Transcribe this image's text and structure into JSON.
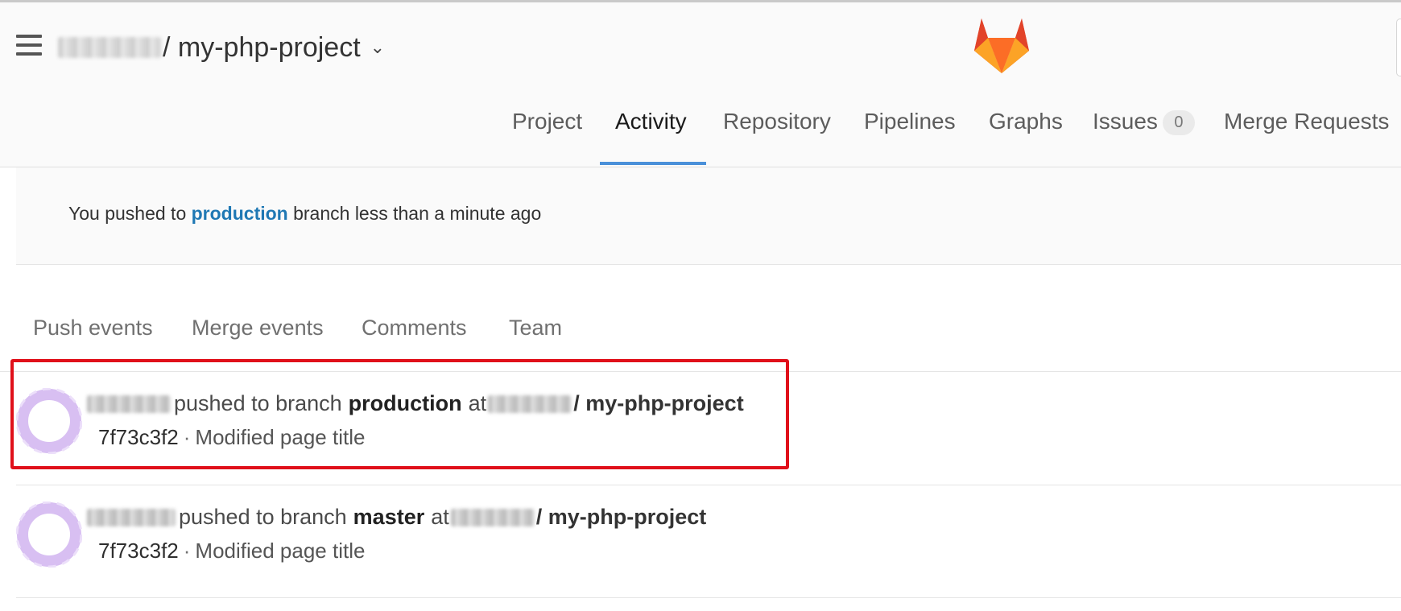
{
  "header": {
    "project_name": "/ my-php-project",
    "menu_icon": "hamburger-menu-icon",
    "dropdown_icon": "chevron-down-icon",
    "logo_icon": "gitlab-fox-logo"
  },
  "nav": {
    "tabs": [
      {
        "label": "Project"
      },
      {
        "label": "Activity",
        "active": true
      },
      {
        "label": "Repository"
      },
      {
        "label": "Pipelines"
      },
      {
        "label": "Graphs"
      },
      {
        "label": "Issues",
        "badge": "0"
      },
      {
        "label": "Merge Requests"
      }
    ]
  },
  "notice": {
    "prefix": "You pushed to",
    "branch": "production",
    "suffix": "branch less than a minute ago"
  },
  "filters": {
    "tabs": [
      "Push events",
      "Merge events",
      "Comments",
      "Team"
    ]
  },
  "events": [
    {
      "action": "pushed to branch",
      "branch": "production",
      "at": "at",
      "project": "/ my-php-project",
      "sha": "7f73c3f2",
      "separator": "·",
      "message": "Modified page title",
      "highlighted": true
    },
    {
      "action": "pushed to branch",
      "branch": "master",
      "at": "at",
      "project": "/ my-php-project",
      "sha": "7f73c3f2",
      "separator": "·",
      "message": "Modified page title",
      "highlighted": false
    }
  ],
  "colors": {
    "accent": "#4a90d9",
    "link": "#1f78b4",
    "highlight": "#e0101a",
    "avatar": "#d5b8f0"
  }
}
